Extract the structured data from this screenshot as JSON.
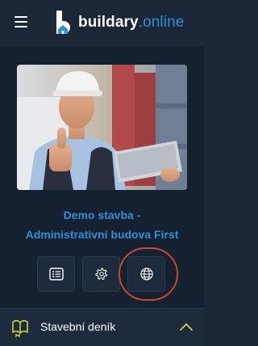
{
  "header": {
    "brand_main": "buildary",
    "brand_tld": ".online",
    "icons": [
      "hamburger-menu-icon",
      "logo-icon"
    ]
  },
  "project": {
    "title_line1": "Demo stavba -",
    "title_line2": "Administrativní budova First"
  },
  "actions": [
    {
      "icon": "list-icon"
    },
    {
      "icon": "gear-icon"
    },
    {
      "icon": "globe-icon",
      "highlighted": true
    }
  ],
  "menu": {
    "label": "Stavební deník",
    "icon": "book-icon",
    "expanded": true
  },
  "colors": {
    "background": "#1b2636",
    "accent": "#2e8fd4",
    "chevron": "#c8d43a",
    "highlight": "#c24a33"
  }
}
